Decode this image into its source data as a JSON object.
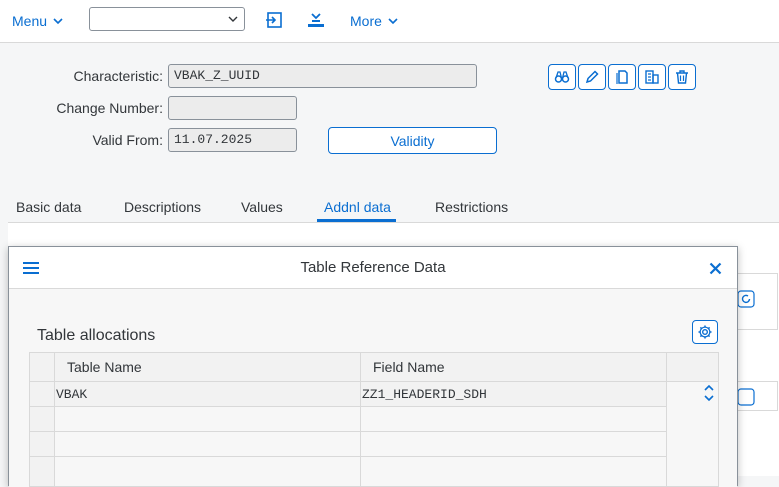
{
  "toolbar": {
    "menu_label": "Menu",
    "dropdown_value": "",
    "more_label": "More",
    "icons": [
      "enter-icon",
      "collapse-icon"
    ]
  },
  "header": {
    "characteristic_label": "Characteristic:",
    "characteristic_value": "VBAK_Z_UUID",
    "change_number_label": "Change Number:",
    "change_number_value": "",
    "valid_from_label": "Valid From:",
    "valid_from_value": "11.07.2025",
    "validity_button": "Validity",
    "action_icons": [
      "display-icon",
      "edit-icon",
      "copy-icon",
      "create-icon",
      "delete-icon"
    ]
  },
  "tabs": [
    {
      "label": "Basic data",
      "active": false
    },
    {
      "label": "Descriptions",
      "active": false
    },
    {
      "label": "Values",
      "active": false
    },
    {
      "label": "Addnl data",
      "active": true
    },
    {
      "label": "Restrictions",
      "active": false
    }
  ],
  "dialog": {
    "title": "Table Reference Data",
    "section_title": "Table allocations",
    "columns": [
      "Table Name",
      "Field Name"
    ],
    "rows": [
      [
        "VBAK",
        "ZZ1_HEADERID_SDH"
      ],
      [
        "",
        ""
      ],
      [
        "",
        ""
      ],
      [
        "",
        ""
      ]
    ]
  },
  "colors": {
    "accent": "#0a6ed1",
    "background": "#f5f6f7",
    "text": "#32363a"
  }
}
